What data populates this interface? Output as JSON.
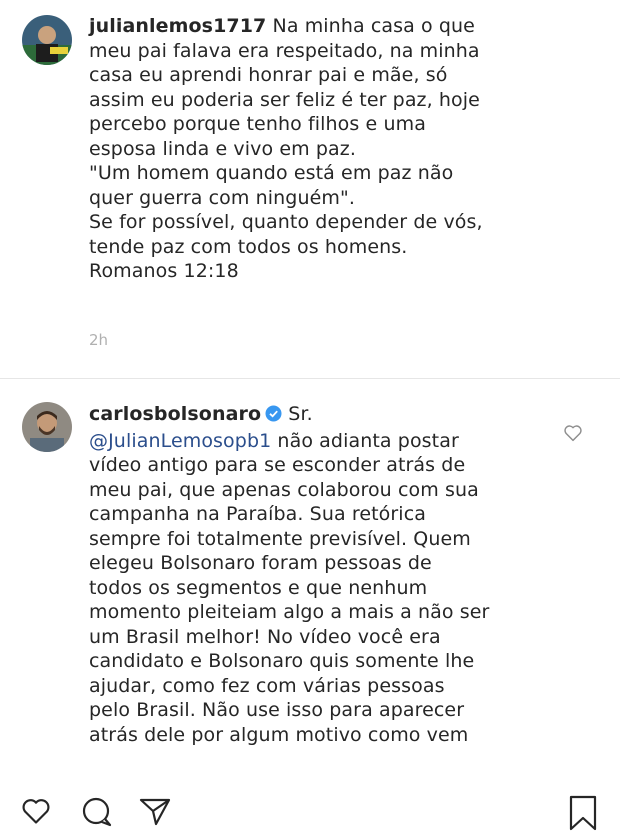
{
  "comments": [
    {
      "username": "julianlemos1717",
      "lines": [
        "Na minha casa o que",
        "meu pai falava era respeitado, na minha",
        "casa eu aprendi honrar pai e mãe, só",
        "assim eu poderia ser feliz é ter paz, hoje",
        "percebo porque tenho filhos e uma",
        "esposa linda e vivo em paz.",
        "\"Um homem quando está em paz não",
        "quer guerra com ninguém\".",
        "Se for possível, quanto depender de vós,",
        "tende paz com todos os homens.",
        "Romanos 12:18"
      ],
      "time": "2h"
    },
    {
      "username": "carlosbolsonaro",
      "verified": true,
      "first_text": "Sr.",
      "mention": "@JulianLemosopb1",
      "mention_rest": " não adianta postar",
      "lines": [
        "vídeo antigo para se esconder atrás de",
        "meu pai, que apenas colaborou com sua",
        "campanha na Paraíba. Sua retórica",
        "sempre foi totalmente previsível. Quem",
        "elegeu Bolsonaro foram pessoas de",
        "todos os segmentos e que nenhum",
        "momento pleiteiam algo a mais a não ser",
        "um Brasil melhor! No vídeo você era",
        "candidato e Bolsonaro quis somente lhe",
        "ajudar, como fez com várias pessoas",
        "pelo Brasil. Não use isso para aparecer",
        "atrás dele por algum motivo como vem"
      ]
    }
  ],
  "icons": {
    "like": "heart-icon",
    "comment": "comment-icon",
    "share": "send-icon",
    "save": "bookmark-icon",
    "comment_like": "heart-icon"
  }
}
